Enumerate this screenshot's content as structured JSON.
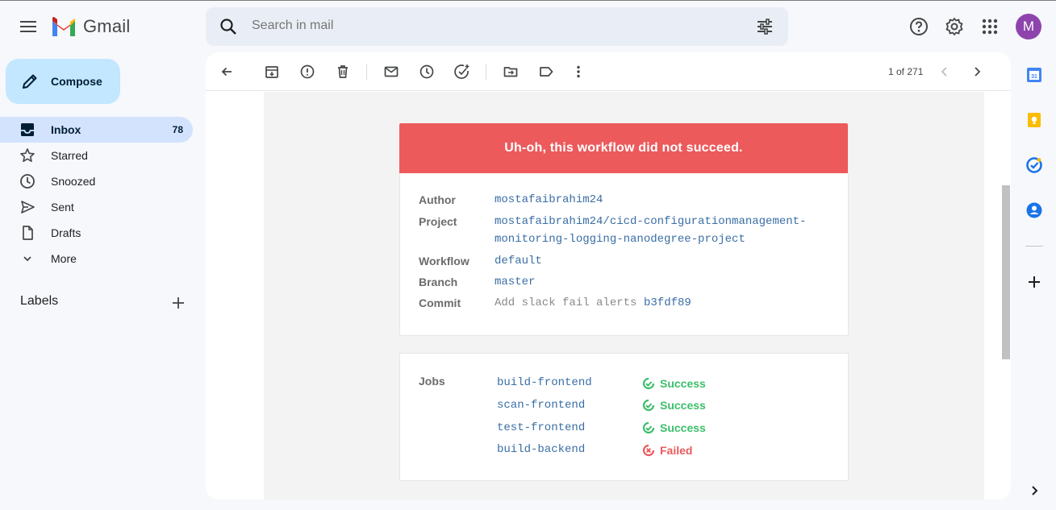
{
  "app": {
    "name": "Gmail",
    "avatar_letter": "M"
  },
  "search": {
    "placeholder": "Search in mail"
  },
  "compose": {
    "label": "Compose"
  },
  "sidebar": {
    "items": [
      {
        "label": "Inbox",
        "count": "78",
        "icon": "inbox-icon"
      },
      {
        "label": "Starred",
        "icon": "star-icon"
      },
      {
        "label": "Snoozed",
        "icon": "clock-icon"
      },
      {
        "label": "Sent",
        "icon": "send-icon"
      },
      {
        "label": "Drafts",
        "icon": "file-icon"
      },
      {
        "label": "More",
        "icon": "chevron-down-icon"
      }
    ],
    "labels_title": "Labels"
  },
  "toolbar": {
    "pager": "1 of 271"
  },
  "email": {
    "banner": "Uh-oh, this workflow did not succeed.",
    "details": {
      "author_label": "Author",
      "author": "mostafaibrahim24",
      "project_label": "Project",
      "project_line1": "mostafaibrahim24/cicd-configurationmanagement-",
      "project_line2": "monitoring-logging-nanodegree-project",
      "workflow_label": "Workflow",
      "workflow": "default",
      "branch_label": "Branch",
      "branch": "master",
      "commit_label": "Commit",
      "commit_message": "Add slack fail alerts",
      "commit_hash": "b3fdf89"
    },
    "jobs_label": "Jobs",
    "jobs": [
      {
        "name": "build-frontend",
        "status": "Success"
      },
      {
        "name": "scan-frontend",
        "status": "Success"
      },
      {
        "name": "test-frontend",
        "status": "Success"
      },
      {
        "name": "build-backend",
        "status": "Failed"
      }
    ]
  },
  "colors": {
    "failure": "#ec5a5c",
    "success": "#3dbf6b",
    "link": "#3a6ea5",
    "compose_bg": "#c2e7ff",
    "active_nav": "#d3e3fd"
  }
}
